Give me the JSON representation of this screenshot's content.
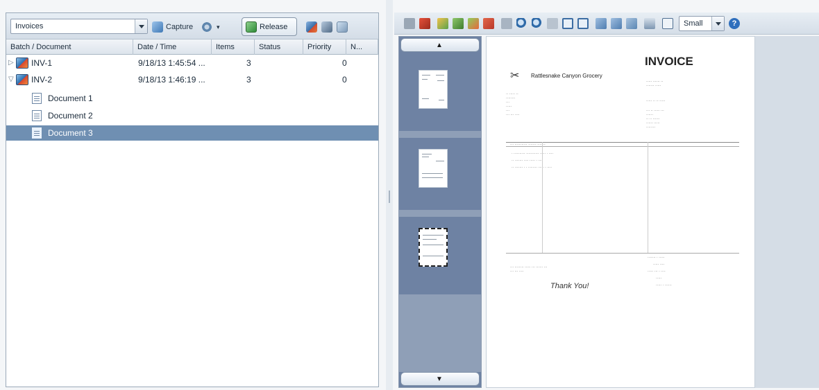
{
  "left_toolbar": {
    "queue_select": "Invoices",
    "capture_label": "Capture",
    "release_label": "Release"
  },
  "grid": {
    "columns": [
      "Batch / Document",
      "Date / Time",
      "Items",
      "Status",
      "Priority",
      "N..."
    ],
    "rows": [
      {
        "kind": "batch",
        "expander": "▷",
        "name": "INV-1",
        "date": "9/18/13 1:45:54 ...",
        "items": "3",
        "status": "",
        "priority": "0"
      },
      {
        "kind": "batch",
        "expander": "▽",
        "name": "INV-2",
        "date": "9/18/13 1:46:19 ...",
        "items": "3",
        "status": "",
        "priority": "0"
      },
      {
        "kind": "doc",
        "name": "Document 1"
      },
      {
        "kind": "doc",
        "name": "Document 2"
      },
      {
        "kind": "doc",
        "name": "Document 3",
        "selected": true
      }
    ]
  },
  "right_toolbar": {
    "zoom_select": "Small",
    "help_icon": "help-icon"
  },
  "invoice": {
    "heading": "INVOICE",
    "company": "Rattlesnake Canyon Grocery",
    "thank_you": "Thank You!"
  },
  "colors": {
    "selected_row": "#6f8fb2",
    "thumb_panel": "#6e82a3"
  }
}
